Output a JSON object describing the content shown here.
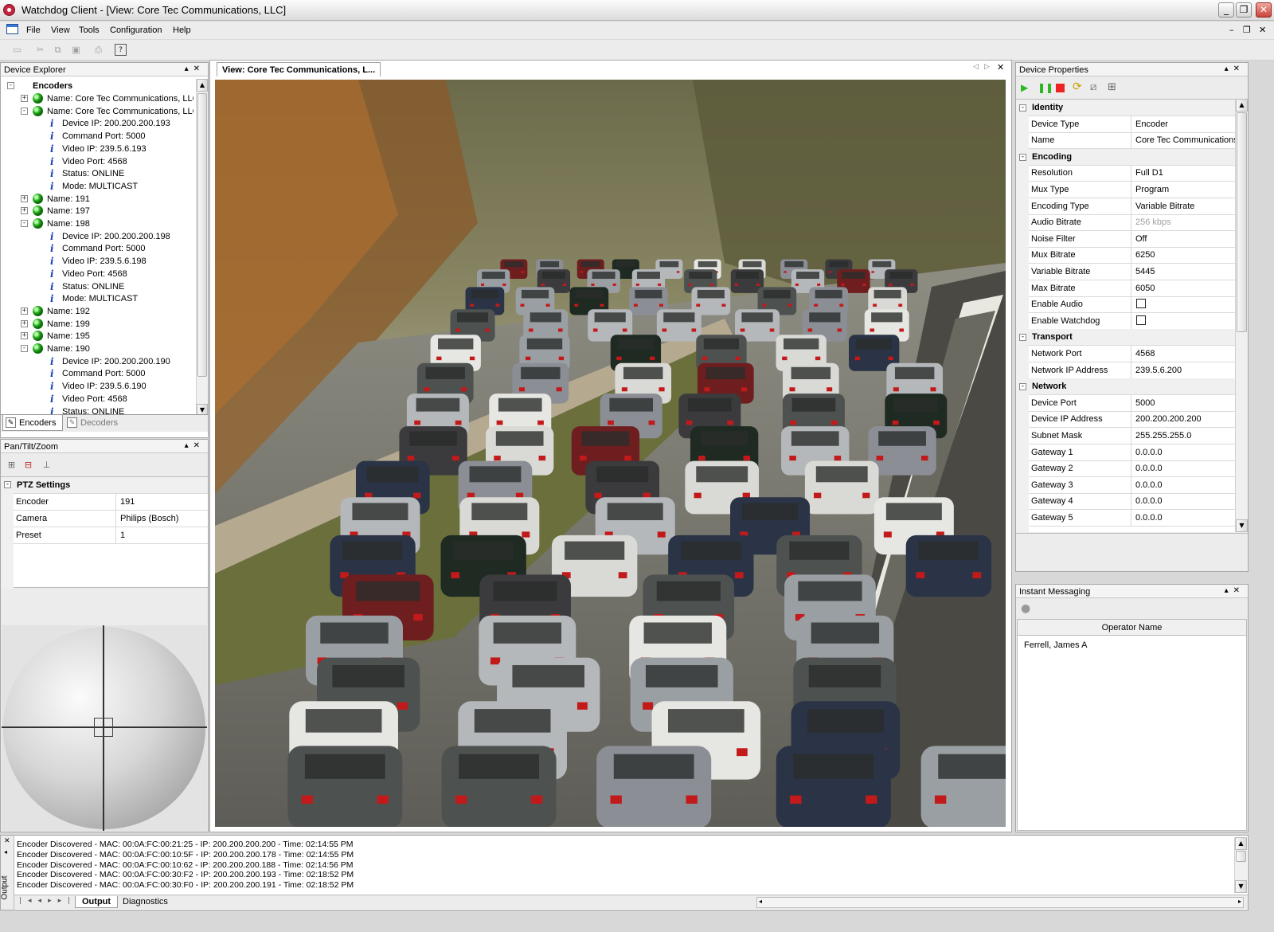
{
  "window": {
    "title": "Watchdog Client - [View: Core Tec Communications, LLC]"
  },
  "menu": [
    "File",
    "View",
    "Tools",
    "Configuration",
    "Help"
  ],
  "device_explorer": {
    "title": "Device Explorer",
    "root": "Encoders",
    "items": [
      {
        "text": "Name: Core Tec Communications, LLC",
        "type": "node",
        "state": "+"
      },
      {
        "text": "Name: Core Tec Communications, LLC",
        "type": "node",
        "state": "-"
      },
      {
        "text": "Device IP: 200.200.200.193",
        "type": "prop"
      },
      {
        "text": "Command Port: 5000",
        "type": "prop"
      },
      {
        "text": "Video IP: 239.5.6.193",
        "type": "prop"
      },
      {
        "text": "Video Port: 4568",
        "type": "prop"
      },
      {
        "text": "Status: ONLINE",
        "type": "prop"
      },
      {
        "text": "Mode: MULTICAST",
        "type": "prop"
      },
      {
        "text": "Name: 191",
        "type": "node",
        "state": "+"
      },
      {
        "text": "Name: 197",
        "type": "node",
        "state": "+"
      },
      {
        "text": "Name: 198",
        "type": "node",
        "state": "-"
      },
      {
        "text": "Device IP: 200.200.200.198",
        "type": "prop"
      },
      {
        "text": "Command Port: 5000",
        "type": "prop"
      },
      {
        "text": "Video IP: 239.5.6.198",
        "type": "prop"
      },
      {
        "text": "Video Port: 4568",
        "type": "prop"
      },
      {
        "text": "Status: ONLINE",
        "type": "prop"
      },
      {
        "text": "Mode: MULTICAST",
        "type": "prop"
      },
      {
        "text": "Name: 192",
        "type": "node",
        "state": "+"
      },
      {
        "text": "Name: 199",
        "type": "node",
        "state": "+"
      },
      {
        "text": "Name: 195",
        "type": "node",
        "state": "+"
      },
      {
        "text": "Name: 190",
        "type": "node",
        "state": "-"
      },
      {
        "text": "Device IP: 200.200.200.190",
        "type": "prop"
      },
      {
        "text": "Command Port: 5000",
        "type": "prop"
      },
      {
        "text": "Video IP: 239.5.6.190",
        "type": "prop"
      },
      {
        "text": "Video Port: 4568",
        "type": "prop"
      },
      {
        "text": "Status: ONLINE",
        "type": "prop"
      }
    ],
    "tabs": [
      "Encoders",
      "Decoders"
    ]
  },
  "ptz": {
    "title": "Pan/Tilt/Zoom",
    "category": "PTZ Settings",
    "rows": [
      {
        "name": "Encoder",
        "value": "191"
      },
      {
        "name": "Camera",
        "value": "Philips (Bosch)"
      },
      {
        "name": "Preset",
        "value": "1"
      }
    ]
  },
  "view": {
    "tab_label": "View: Core Tec Communications, L..."
  },
  "device_properties": {
    "title": "Device Properties",
    "sections": [
      {
        "name": "Identity",
        "rows": [
          {
            "name": "Device Type",
            "value": "Encoder"
          },
          {
            "name": "Name",
            "value": "Core Tec Communications"
          }
        ]
      },
      {
        "name": "Encoding",
        "rows": [
          {
            "name": "Resolution",
            "value": "Full D1"
          },
          {
            "name": "Mux Type",
            "value": "Program"
          },
          {
            "name": "Encoding Type",
            "value": "Variable Bitrate"
          },
          {
            "name": "Audio Bitrate",
            "value": "256 kbps",
            "disabled": true
          },
          {
            "name": "Noise Filter",
            "value": "Off"
          },
          {
            "name": "Mux Bitrate",
            "value": "6250"
          },
          {
            "name": "Variable Bitrate",
            "value": "5445"
          },
          {
            "name": "Max Bitrate",
            "value": "6050"
          },
          {
            "name": "Enable Audio",
            "value": "",
            "checkbox": true
          },
          {
            "name": "Enable Watchdog",
            "value": "",
            "checkbox": true
          }
        ]
      },
      {
        "name": "Transport",
        "rows": [
          {
            "name": "Network Port",
            "value": "4568"
          },
          {
            "name": "Network IP Address",
            "value": "239.5.6.200"
          }
        ]
      },
      {
        "name": "Network",
        "rows": [
          {
            "name": "Device Port",
            "value": "5000"
          },
          {
            "name": "Device IP Address",
            "value": "200.200.200.200"
          },
          {
            "name": "Subnet Mask",
            "value": "255.255.255.0"
          },
          {
            "name": "Gateway 1",
            "value": "0.0.0.0"
          },
          {
            "name": "Gateway 2",
            "value": "0.0.0.0"
          },
          {
            "name": "Gateway 3",
            "value": "0.0.0.0"
          },
          {
            "name": "Gateway 4",
            "value": "0.0.0.0"
          },
          {
            "name": "Gateway 5",
            "value": "0.0.0.0"
          }
        ]
      }
    ]
  },
  "messaging": {
    "title": "Instant Messaging",
    "column": "Operator Name",
    "operators": [
      "Ferrell, James A"
    ]
  },
  "output": {
    "side_label": "Output",
    "lines": [
      "Encoder Discovered - MAC: 00:0A:FC:00:21:25 - IP: 200.200.200.200 - Time: 02:14:55 PM",
      "Encoder Discovered - MAC: 00:0A:FC:00:10:5F - IP: 200.200.200.178 - Time: 02:14:55 PM",
      "Encoder Discovered - MAC: 00:0A:FC:00:10:62 - IP: 200.200.200.188 - Time: 02:14:56 PM",
      "Encoder Discovered - MAC: 00:0A:FC:00:30:F2 - IP: 200.200.200.193 - Time: 02:18:52 PM",
      "Encoder Discovered - MAC: 00:0A:FC:00:30:F0 - IP: 200.200.200.191 - Time: 02:18:52 PM"
    ],
    "tabs": [
      "Output",
      "Diagnostics"
    ]
  }
}
